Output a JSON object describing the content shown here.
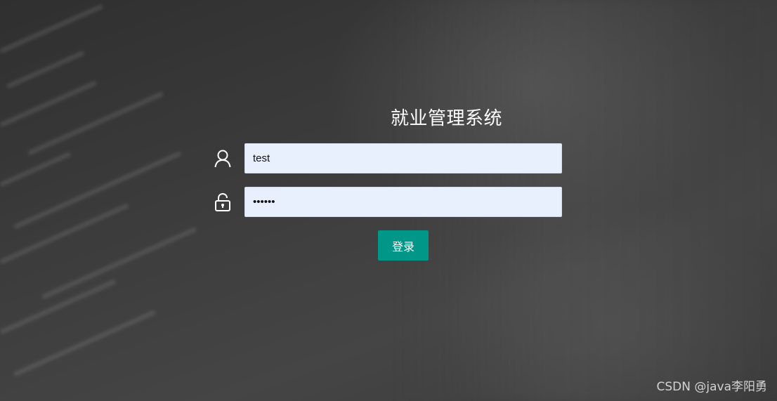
{
  "app": {
    "title": "就业管理系统"
  },
  "form": {
    "username": {
      "value": "test",
      "icon": "user-icon"
    },
    "password": {
      "value": "••••••",
      "icon": "unlock-icon"
    },
    "submit_label": "登录"
  },
  "watermark": "CSDN @java李阳勇",
  "colors": {
    "button": "#009688",
    "input_bg": "#e8f0fe",
    "title": "#ffffff"
  }
}
